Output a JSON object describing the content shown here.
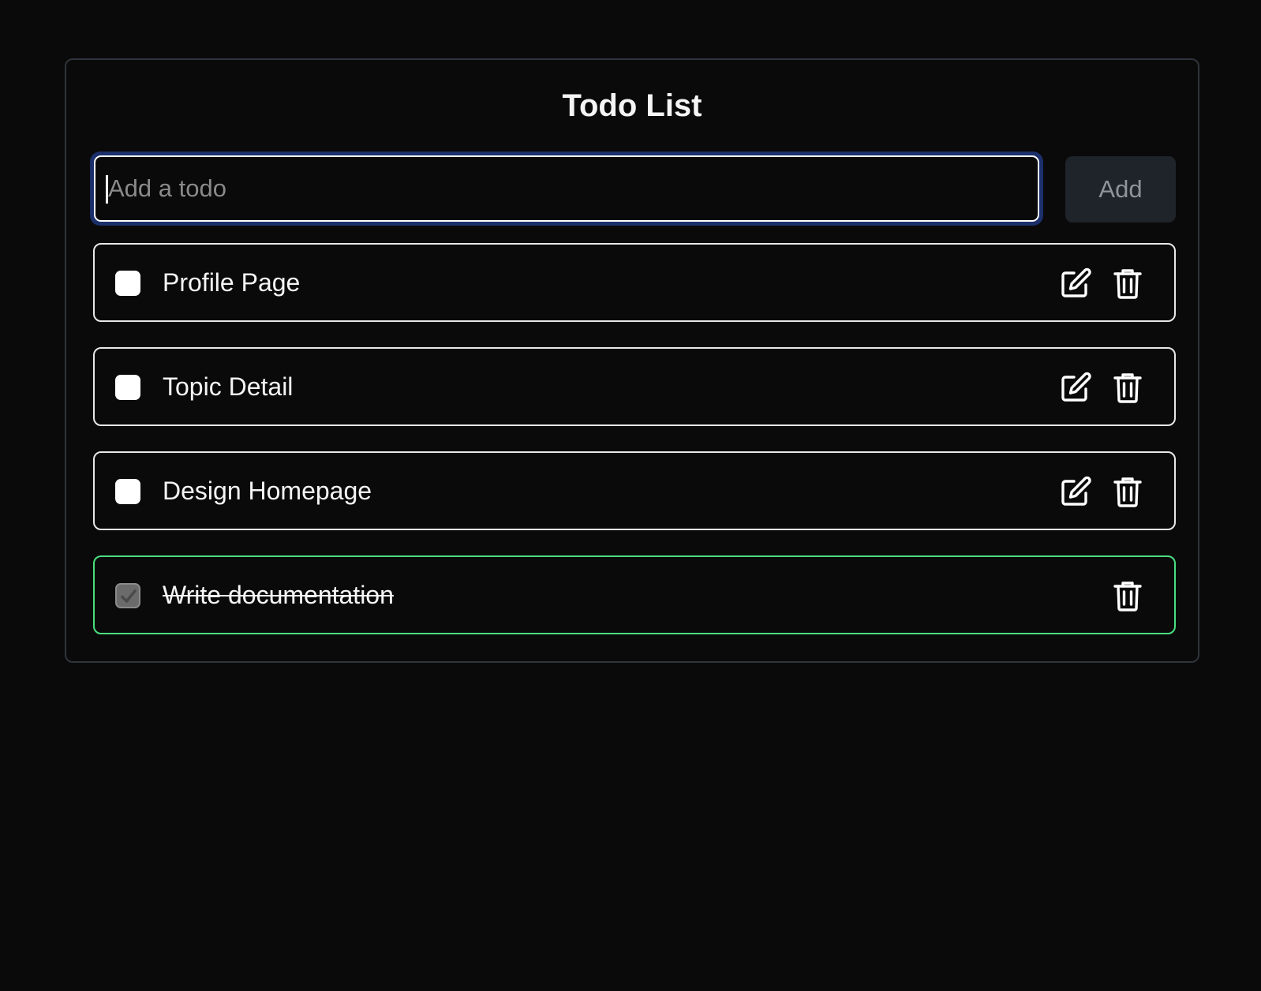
{
  "app": {
    "title": "Todo List"
  },
  "input": {
    "placeholder": "Add a todo",
    "value": ""
  },
  "add_button": {
    "label": "Add"
  },
  "todos": [
    {
      "text": "Profile Page",
      "completed": false,
      "actions": [
        "edit-icon",
        "trash-icon"
      ]
    },
    {
      "text": "Topic Detail",
      "completed": false,
      "actions": [
        "edit-icon",
        "trash-icon"
      ]
    },
    {
      "text": "Design Homepage",
      "completed": false,
      "actions": [
        "edit-icon",
        "trash-icon"
      ]
    },
    {
      "text": "Write documentation",
      "completed": true,
      "actions": [
        "trash-icon"
      ]
    }
  ],
  "colors": {
    "background": "#0a0a0a",
    "card_border": "#2f343c",
    "focus_ring": "#1b2f6b",
    "completed_border": "#4ade80",
    "add_button_bg": "#1f232a",
    "add_button_text": "#8f939a"
  }
}
